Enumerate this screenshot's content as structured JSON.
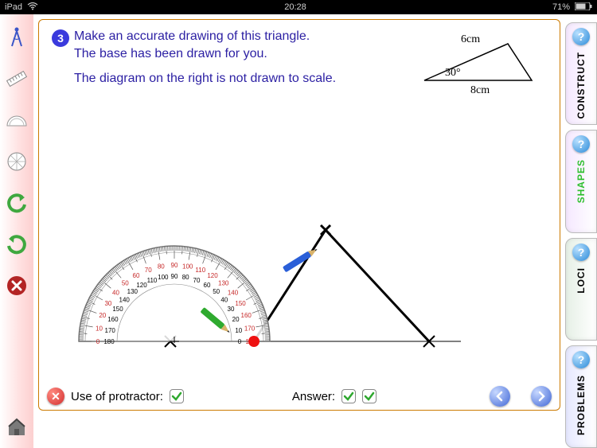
{
  "statusbar": {
    "device": "iPad",
    "time": "20:28",
    "battery": "71%"
  },
  "sidebar_tools": {
    "compass": "compass-tool",
    "ruler": "ruler-tool",
    "protractor": "protractor-tool",
    "eraser": "eraser-tool",
    "undo": "undo",
    "redo": "redo",
    "clear": "clear",
    "home": "home"
  },
  "question": {
    "number": "3",
    "line1": "Make an accurate drawing of this triangle.",
    "line2": "The base has been drawn for you.",
    "line3": "The diagram on the right is not drawn to scale."
  },
  "ref_triangle": {
    "side1": "6cm",
    "angle": "30°",
    "base": "8cm"
  },
  "bottombar": {
    "protractor_label": "Use of protractor:",
    "answer_label": "Answer:"
  },
  "tabs": {
    "construct": "CONSTRUCT",
    "shapes": "SHAPES",
    "loci": "LOCI",
    "problems": "PROBLEMS"
  },
  "chart_data": {
    "type": "diagram",
    "figure": "triangle",
    "given": {
      "base_cm": 8,
      "side_cm": 6,
      "included_angle_deg": 30
    },
    "task": "construct triangle from given base with 30° angle and 6cm side",
    "notes": "reference triangle not to scale; base pre-drawn on canvas"
  }
}
